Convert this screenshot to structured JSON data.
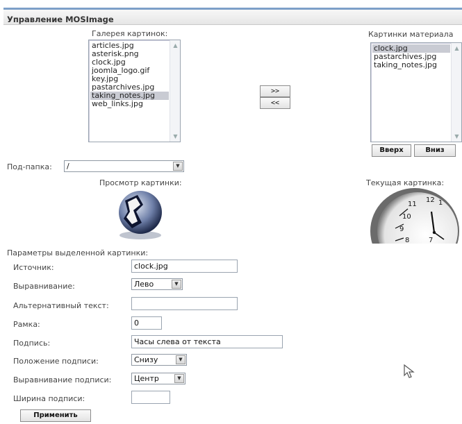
{
  "panel": {
    "title": "Управление MOSImage"
  },
  "gallery": {
    "label": "Галерея картинок:",
    "items": [
      "articles.jpg",
      "asterisk.png",
      "clock.jpg",
      "joomla_logo.gif",
      "key.jpg",
      "pastarchives.jpg",
      "taking_notes.jpg",
      "web_links.jpg"
    ],
    "selected": "taking_notes.jpg"
  },
  "move": {
    "add": ">>",
    "remove": "<<"
  },
  "content_images": {
    "label": "Картинки материала",
    "items": [
      "clock.jpg",
      "pastarchives.jpg",
      "taking_notes.jpg"
    ],
    "selected": "clock.jpg",
    "up": "Вверх",
    "down": "Вниз"
  },
  "subfolder": {
    "label": "Под-папка:",
    "value": "/"
  },
  "preview": {
    "label": "Просмотр картинки:",
    "icon": "globe-icon"
  },
  "current": {
    "label": "Текущая картинка:",
    "icon": "clock-icon"
  },
  "params": {
    "title": "Параметры выделенной картинки:",
    "source": {
      "label": "Источник:",
      "value": "clock.jpg"
    },
    "align": {
      "label": "Выравнивание:",
      "value": "Лево"
    },
    "alt": {
      "label": "Альтернативный текст:",
      "value": ""
    },
    "border": {
      "label": "Рамка:",
      "value": "0"
    },
    "caption": {
      "label": "Подпись:",
      "value": "Часы слева от текста"
    },
    "caption_position": {
      "label": "Положение подписи:",
      "value": "Снизу"
    },
    "caption_align": {
      "label": "Выравнивание подписи:",
      "value": "Центр"
    },
    "caption_width": {
      "label": "Ширина подписи:",
      "value": ""
    }
  },
  "apply": "Применить",
  "colors": {
    "accent": "#7da0c8",
    "selection": "#c9cbd3"
  }
}
